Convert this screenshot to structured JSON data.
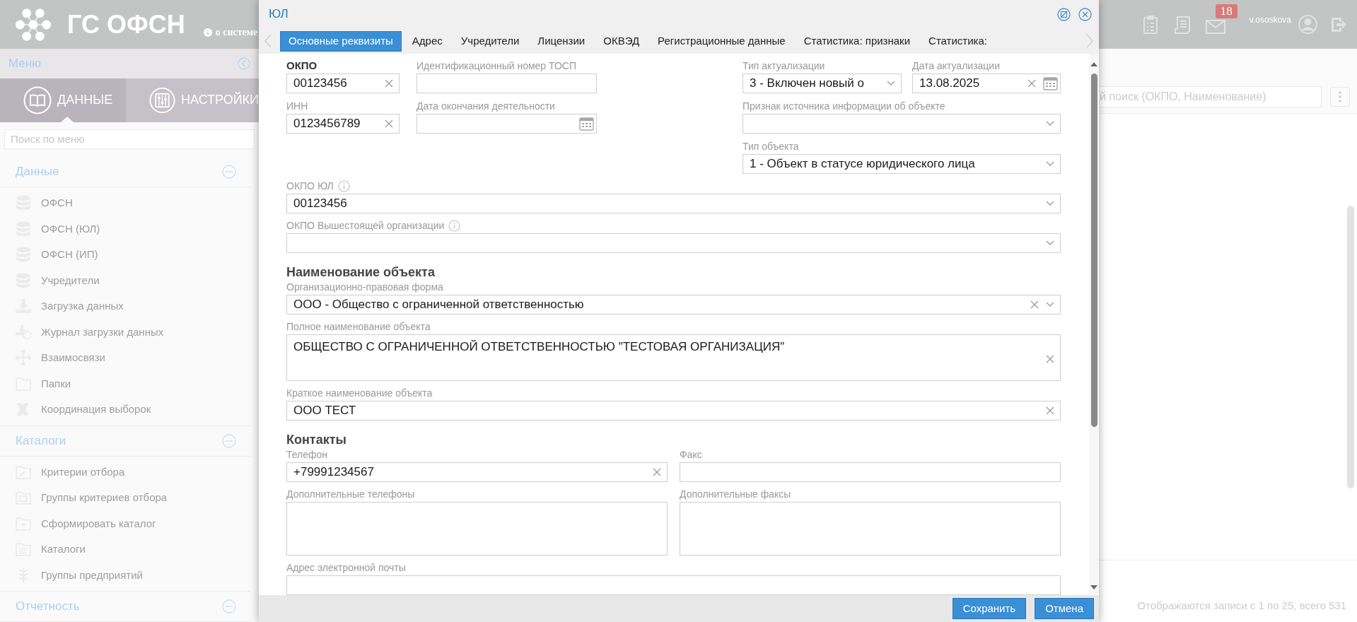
{
  "header": {
    "app_title": "ГС ОФСН",
    "about_link": "о системе",
    "mail_badge": "18",
    "username": "v.ososkova"
  },
  "sidebar": {
    "title": "Меню",
    "tabs": [
      {
        "label": "ДАННЫЕ",
        "selected": true
      },
      {
        "label": "НАСТРОЙКИ",
        "selected": false
      }
    ],
    "search_placeholder": "Поиск по меню",
    "sections": [
      {
        "title": "Данные",
        "expanded": true,
        "items": [
          "ОФСН",
          "ОФСН (ЮЛ)",
          "ОФСН (ИП)",
          "Учредители",
          "Загрузка данных",
          "Журнал загрузки данных",
          "Взаимосвязи",
          "Папки",
          "Координация выборок"
        ]
      },
      {
        "title": "Каталоги",
        "expanded": true,
        "items": [
          "Критерии отбора",
          "Группы критериев отбора",
          "Сформировать каталог",
          "Каталоги",
          "Группы предприятий"
        ]
      },
      {
        "title": "Отчетность",
        "expanded": true
      }
    ]
  },
  "main": {
    "search_text": "й поиск (ОКПО, Наименование)",
    "status": "Отображаются записи с 1 по 25, всего 531"
  },
  "dialog": {
    "title": "ЮЛ",
    "tabs": [
      {
        "label": "Основные реквизиты",
        "selected": true
      },
      {
        "label": "Адрес",
        "selected": false
      },
      {
        "label": "Учредители",
        "selected": false
      },
      {
        "label": "Лицензии",
        "selected": false
      },
      {
        "label": "ОКВЭД",
        "selected": false
      },
      {
        "label": "Регистрационные данные",
        "selected": false
      },
      {
        "label": "Статистика: признаки",
        "selected": false
      },
      {
        "label": "Статистика:",
        "selected": false
      }
    ],
    "top_left": [
      [
        {
          "kind": "text",
          "label": "ОКПО",
          "required": true,
          "value": "00123456",
          "clearable": true
        },
        {
          "kind": "text",
          "label": "Идентификационный номер ТОСП"
        }
      ],
      [
        {
          "kind": "text",
          "label": "ИНН",
          "value": "0123456789",
          "clearable": true
        },
        {
          "kind": "date",
          "label": "Дата окончания деятельности"
        }
      ]
    ],
    "top_right": [
      [
        {
          "kind": "select",
          "label": "Тип актуализации",
          "value": "3 - Включен новый о"
        },
        {
          "kind": "date",
          "label": "Дата актуализации",
          "value": "13.08.2025",
          "clearable": true
        }
      ],
      [
        {
          "kind": "select",
          "label": "Признак источника информации об объекте"
        }
      ],
      [
        {
          "kind": "select",
          "label": "Тип объекта",
          "value": "1 - Объект в статусе юридического лица"
        }
      ]
    ],
    "sections": [
      {
        "rows": [
          [
            {
              "kind": "select",
              "label": "ОКПО ЮЛ",
              "info": true,
              "value": "00123456"
            }
          ],
          [
            {
              "kind": "select",
              "label": "ОКПО Вышестоящей организации",
              "info": true
            }
          ]
        ]
      },
      {
        "heading": "Наименование объекта",
        "rows": [
          [
            {
              "kind": "select",
              "label": "Организационно-правовая форма",
              "value": "ООО - Общество с ограниченной ответственностью",
              "clearable": true
            }
          ],
          [
            {
              "kind": "textarea",
              "label": "Полное наименование объекта",
              "value": "ОБЩЕСТВО С ОГРАНИЧЕННОЙ ОТВЕТСТВЕННОСТЬЮ \"ТЕСТОВАЯ ОРГАНИЗАЦИЯ\"",
              "clearable": true
            }
          ],
          [
            {
              "kind": "text",
              "label": "Краткое наименование объекта",
              "value": "ООО ТЕСТ",
              "clearable": true
            }
          ]
        ]
      },
      {
        "heading": "Контакты",
        "rows": [
          [
            {
              "kind": "text",
              "label": "Телефон",
              "value": "+79991234567",
              "clearable": true
            },
            {
              "kind": "text",
              "label": "Факс"
            }
          ],
          [
            {
              "kind": "textarea",
              "label": "Дополнительные телефоны"
            },
            {
              "kind": "textarea",
              "label": "Дополнительные факсы"
            }
          ],
          [
            {
              "kind": "text",
              "label": "Адрес электронной почты"
            }
          ]
        ]
      }
    ],
    "buttons": [
      "Сохранить",
      "Отмена"
    ]
  }
}
